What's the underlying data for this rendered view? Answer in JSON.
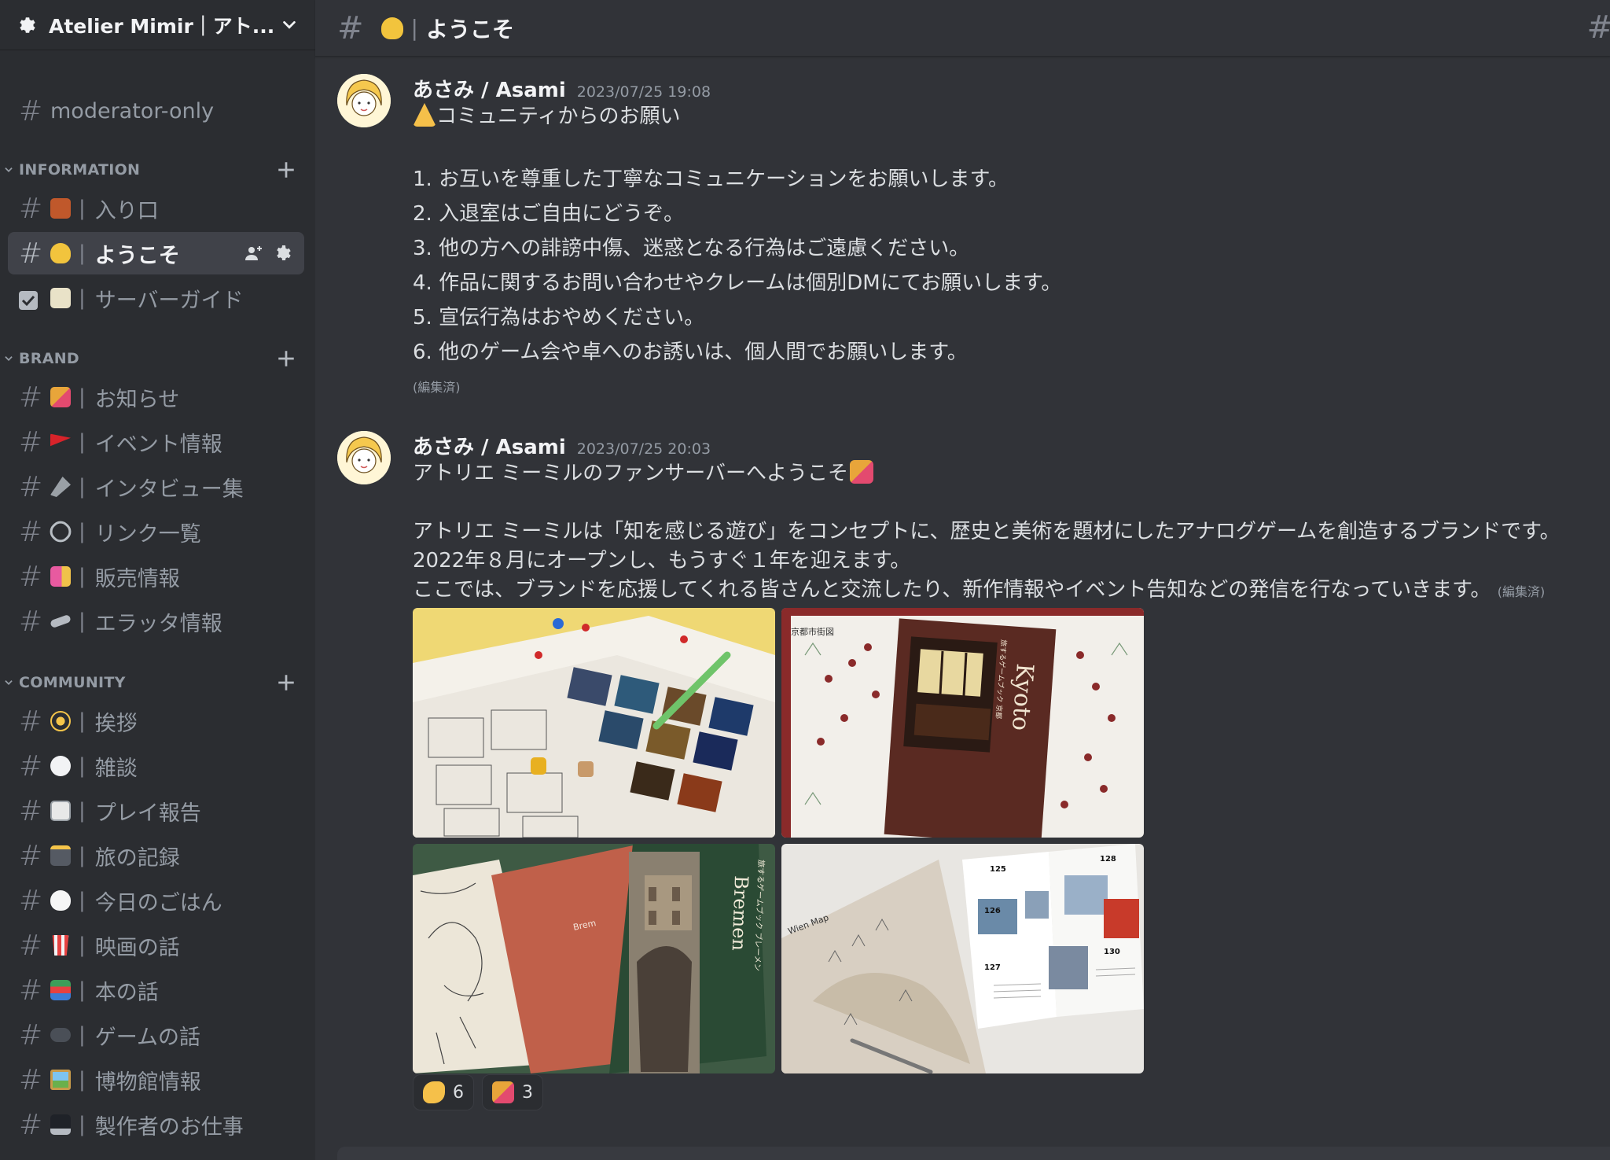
{
  "server": {
    "name": "Atelier Mimir｜アト..."
  },
  "sidebar": {
    "top_channels": [
      {
        "label": "moderator-only"
      }
    ],
    "categories": {
      "information": {
        "label": "INFORMATION",
        "channels": [
          {
            "label": "入り口",
            "emoji": "door-emoji",
            "color": "#c0582b"
          },
          {
            "label": "ようこそ",
            "emoji": "wave-emoji",
            "color": "#f2c43d",
            "active": true
          },
          {
            "label": "サーバーガイド",
            "emoji": "memo-emoji",
            "color": "#e9e2c8"
          }
        ]
      },
      "brand": {
        "label": "BRAND",
        "channels": [
          {
            "label": "お知らせ",
            "emoji": "party-popper-emoji",
            "color": "#e8a53a"
          },
          {
            "label": "イベント情報",
            "emoji": "red-flag-emoji",
            "color": "#d8232a"
          },
          {
            "label": "インタビュー集",
            "emoji": "microphone-emoji",
            "color": "#9aa0a6"
          },
          {
            "label": "リンク一覧",
            "emoji": "link-emoji",
            "color": "#b8bec4"
          },
          {
            "label": "販売情報",
            "emoji": "shopping-bags-emoji",
            "color": "#e85aa0"
          },
          {
            "label": "エラッタ情報",
            "emoji": "pencil-emoji",
            "color": "#b5bac1"
          }
        ]
      },
      "community": {
        "label": "COMMUNITY",
        "channels": [
          {
            "label": "挨拶",
            "emoji": "dizzy-emoji",
            "color": "#f5c54a"
          },
          {
            "label": "雑談",
            "emoji": "speech-balloon-emoji",
            "color": "#f2f3f5"
          },
          {
            "label": "プレイ報告",
            "emoji": "game-die-emoji",
            "color": "#e8e8e8"
          },
          {
            "label": "旅の記録",
            "emoji": "camera-flash-emoji",
            "color": "#555a63"
          },
          {
            "label": "今日のごはん",
            "emoji": "rice-emoji",
            "color": "#f6f6f6"
          },
          {
            "label": "映画の話",
            "emoji": "popcorn-emoji",
            "color": "#e64141"
          },
          {
            "label": "本の話",
            "emoji": "books-emoji",
            "color": "#3c9e59"
          },
          {
            "label": "ゲームの話",
            "emoji": "game-controller-emoji",
            "color": "#4a4f57"
          },
          {
            "label": "博物館情報",
            "emoji": "framed-picture-emoji",
            "color": "#6ab04c"
          },
          {
            "label": "製作者のお仕事",
            "emoji": "laptop-emoji",
            "color": "#1f2228"
          }
        ]
      }
    }
  },
  "channel_header": {
    "hash": "#",
    "emoji": "wave-emoji",
    "title": "ようこそ"
  },
  "messages": [
    {
      "author": "あさみ / Asami",
      "timestamp": "2023/07/25 19:08",
      "lines": [
        "コミュニティからのお願い",
        "",
        "1. お互いを尊重した丁寧なコミュニケーションをお願いします。",
        "2. 入退室はご自由にどうぞ。",
        "3. 他の方への誹謗中傷、迷惑となる行為はご遠慮ください。",
        "4. 作品に関するお問い合わせやクレームは個別DMにてお願いします。",
        "5. 宣伝行為はおやめください。",
        "6. 他のゲーム会や卓へのお誘いは、個人間でお願いします。"
      ],
      "leading_emoji": "folded-hands-emoji",
      "edited": "(編集済)"
    },
    {
      "author": "あさみ / Asami",
      "timestamp": "2023/07/25 20:03",
      "lines": [
        "アトリエ ミーミルのファンサーバーへようこそ",
        "",
        "アトリエ ミーミルは「知を感じる遊び」をコンセプトに、歴史と美術を題材にしたアナログゲームを創造するブランドです。",
        "2022年８月にオープンし、もうすぐ１年を迎えます。",
        "ここでは、ブランドを応援してくれる皆さんと交流したり、新作情報やイベント告知などの発信を行なっていきます。"
      ],
      "trailing_emoji": "party-popper-emoji",
      "edited": "(編集済)",
      "images": [
        {
          "name": "board-game-photo",
          "kyoto_map_header": ""
        },
        {
          "name": "kyoto-book-photo",
          "cover_title": "Kyoto",
          "map_label": "京都市街図",
          "side_label": "旅するゲームブック 京都"
        },
        {
          "name": "bremen-book-photo",
          "cover_title": "Bremen",
          "side_label": "旅するゲームブック ブレーメン",
          "inner_title": "Brem"
        },
        {
          "name": "wien-book-photo",
          "map_label": "Wien Map",
          "page_numbers": [
            "125",
            "126",
            "127",
            "128",
            "130"
          ]
        }
      ],
      "reactions": [
        {
          "emoji": "clapping-hands-emoji",
          "count": "6",
          "color": "#f5c04a"
        },
        {
          "emoji": "party-popper-emoji",
          "count": "3",
          "color": "#e8a53a"
        }
      ]
    }
  ]
}
